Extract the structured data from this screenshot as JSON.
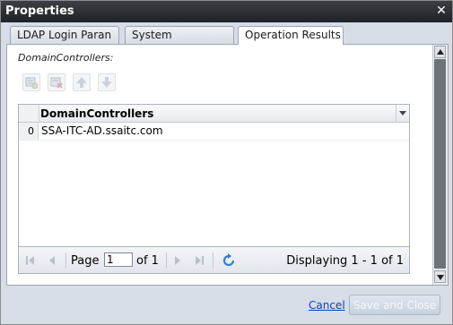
{
  "window": {
    "title": "Properties"
  },
  "tabs": [
    {
      "label": "LDAP Login Paran",
      "active": false
    },
    {
      "label": "System",
      "active": false
    },
    {
      "label": "Operation Results",
      "active": true
    }
  ],
  "section": {
    "label": "DomainControllers:"
  },
  "toolbar": {
    "buttons": [
      {
        "name": "add-row-icon",
        "enabled": false
      },
      {
        "name": "delete-row-icon",
        "enabled": false
      },
      {
        "name": "move-up-icon",
        "enabled": false
      },
      {
        "name": "move-down-icon",
        "enabled": false
      }
    ]
  },
  "grid": {
    "columns": [
      "DomainControllers"
    ],
    "rows": [
      {
        "index": "0",
        "value": "SSA-ITC-AD.ssaitc.com"
      }
    ]
  },
  "pager": {
    "page_label": "Page",
    "page_value": "1",
    "of_label": "of 1",
    "display_text": "Displaying 1 - 1 of 1"
  },
  "footer": {
    "cancel_label": "Cancel",
    "save_label": "Save and Close"
  },
  "colors": {
    "titlebar": "#2b2e32",
    "link": "#0047b3",
    "disabled_button": "#c7d2df"
  }
}
